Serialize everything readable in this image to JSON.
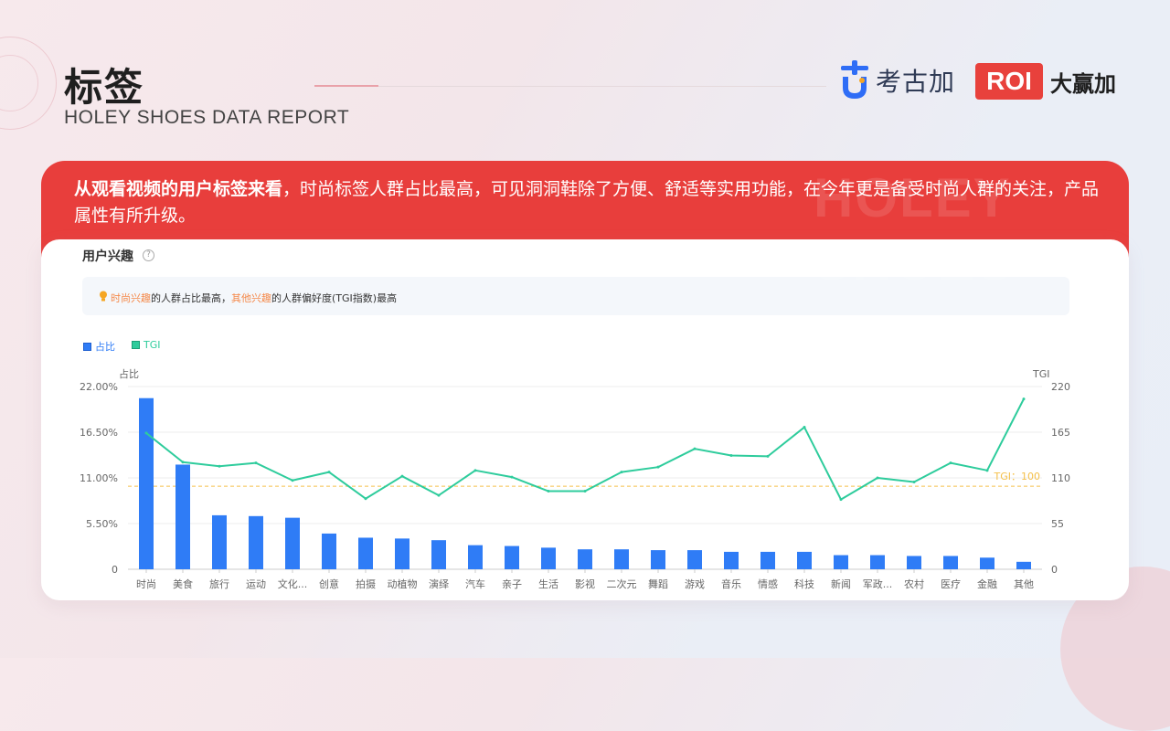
{
  "header": {
    "title": "标签",
    "subtitle": "HOLEY SHOES DATA REPORT",
    "logo1_text": "考古加",
    "logo2_badge": "ROI",
    "logo2_text": "大赢加"
  },
  "banner": {
    "bold_text": "从观看视频的用户标签来看",
    "text": "，时尚标签人群占比最高，可见洞洞鞋除了方便、舒适等实用功能，在今年更是备受时尚人群的关注，产品属性有所升级。",
    "watermark": "HOLEY SHOES"
  },
  "card": {
    "title": "用户兴趣",
    "help": "?",
    "notice_part1": "时尚兴趣",
    "notice_part2": "的人群占比最高，",
    "notice_part3": "其他兴趣",
    "notice_part4": "的人群偏好度(TGI指数)最高"
  },
  "legend": {
    "share": "占比",
    "tgi": "TGI"
  },
  "colors": {
    "bar": "#2f7cf6",
    "line": "#2ecc9c",
    "ref": "#f5c04a",
    "banner": "#e83e3c"
  },
  "chart_data": {
    "type": "bar",
    "categories": [
      "时尚",
      "美食",
      "旅行",
      "运动",
      "文化...",
      "创意",
      "拍摄",
      "动植物",
      "演绎",
      "汽车",
      "亲子",
      "生活",
      "影视",
      "二次元",
      "舞蹈",
      "游戏",
      "音乐",
      "情感",
      "科技",
      "新闻",
      "军政...",
      "农村",
      "医疗",
      "金融",
      "其他"
    ],
    "series": [
      {
        "name": "占比",
        "type": "bar",
        "axis": "left",
        "values": [
          20.6,
          12.6,
          6.5,
          6.4,
          6.2,
          4.3,
          3.8,
          3.7,
          3.5,
          2.9,
          2.8,
          2.6,
          2.4,
          2.4,
          2.3,
          2.3,
          2.1,
          2.1,
          2.1,
          1.7,
          1.7,
          1.6,
          1.6,
          1.4,
          0.9
        ]
      },
      {
        "name": "TGI",
        "type": "line",
        "axis": "right",
        "values": [
          164,
          129,
          124,
          128,
          107,
          117,
          85,
          112,
          89,
          119,
          111,
          94,
          94,
          117,
          123,
          145,
          137,
          136,
          171,
          84,
          110,
          105,
          128,
          119,
          205
        ]
      }
    ],
    "left_axis": {
      "label": "占比",
      "ticks": [
        "0",
        "5.50%",
        "11.00%",
        "16.50%",
        "22.00%"
      ],
      "range": [
        0,
        22
      ]
    },
    "right_axis": {
      "label": "TGI",
      "ticks": [
        "0",
        "55",
        "110",
        "165",
        "220"
      ],
      "range": [
        0,
        220
      ]
    },
    "reference_line": {
      "label": "TGI：100",
      "value": 100
    }
  }
}
